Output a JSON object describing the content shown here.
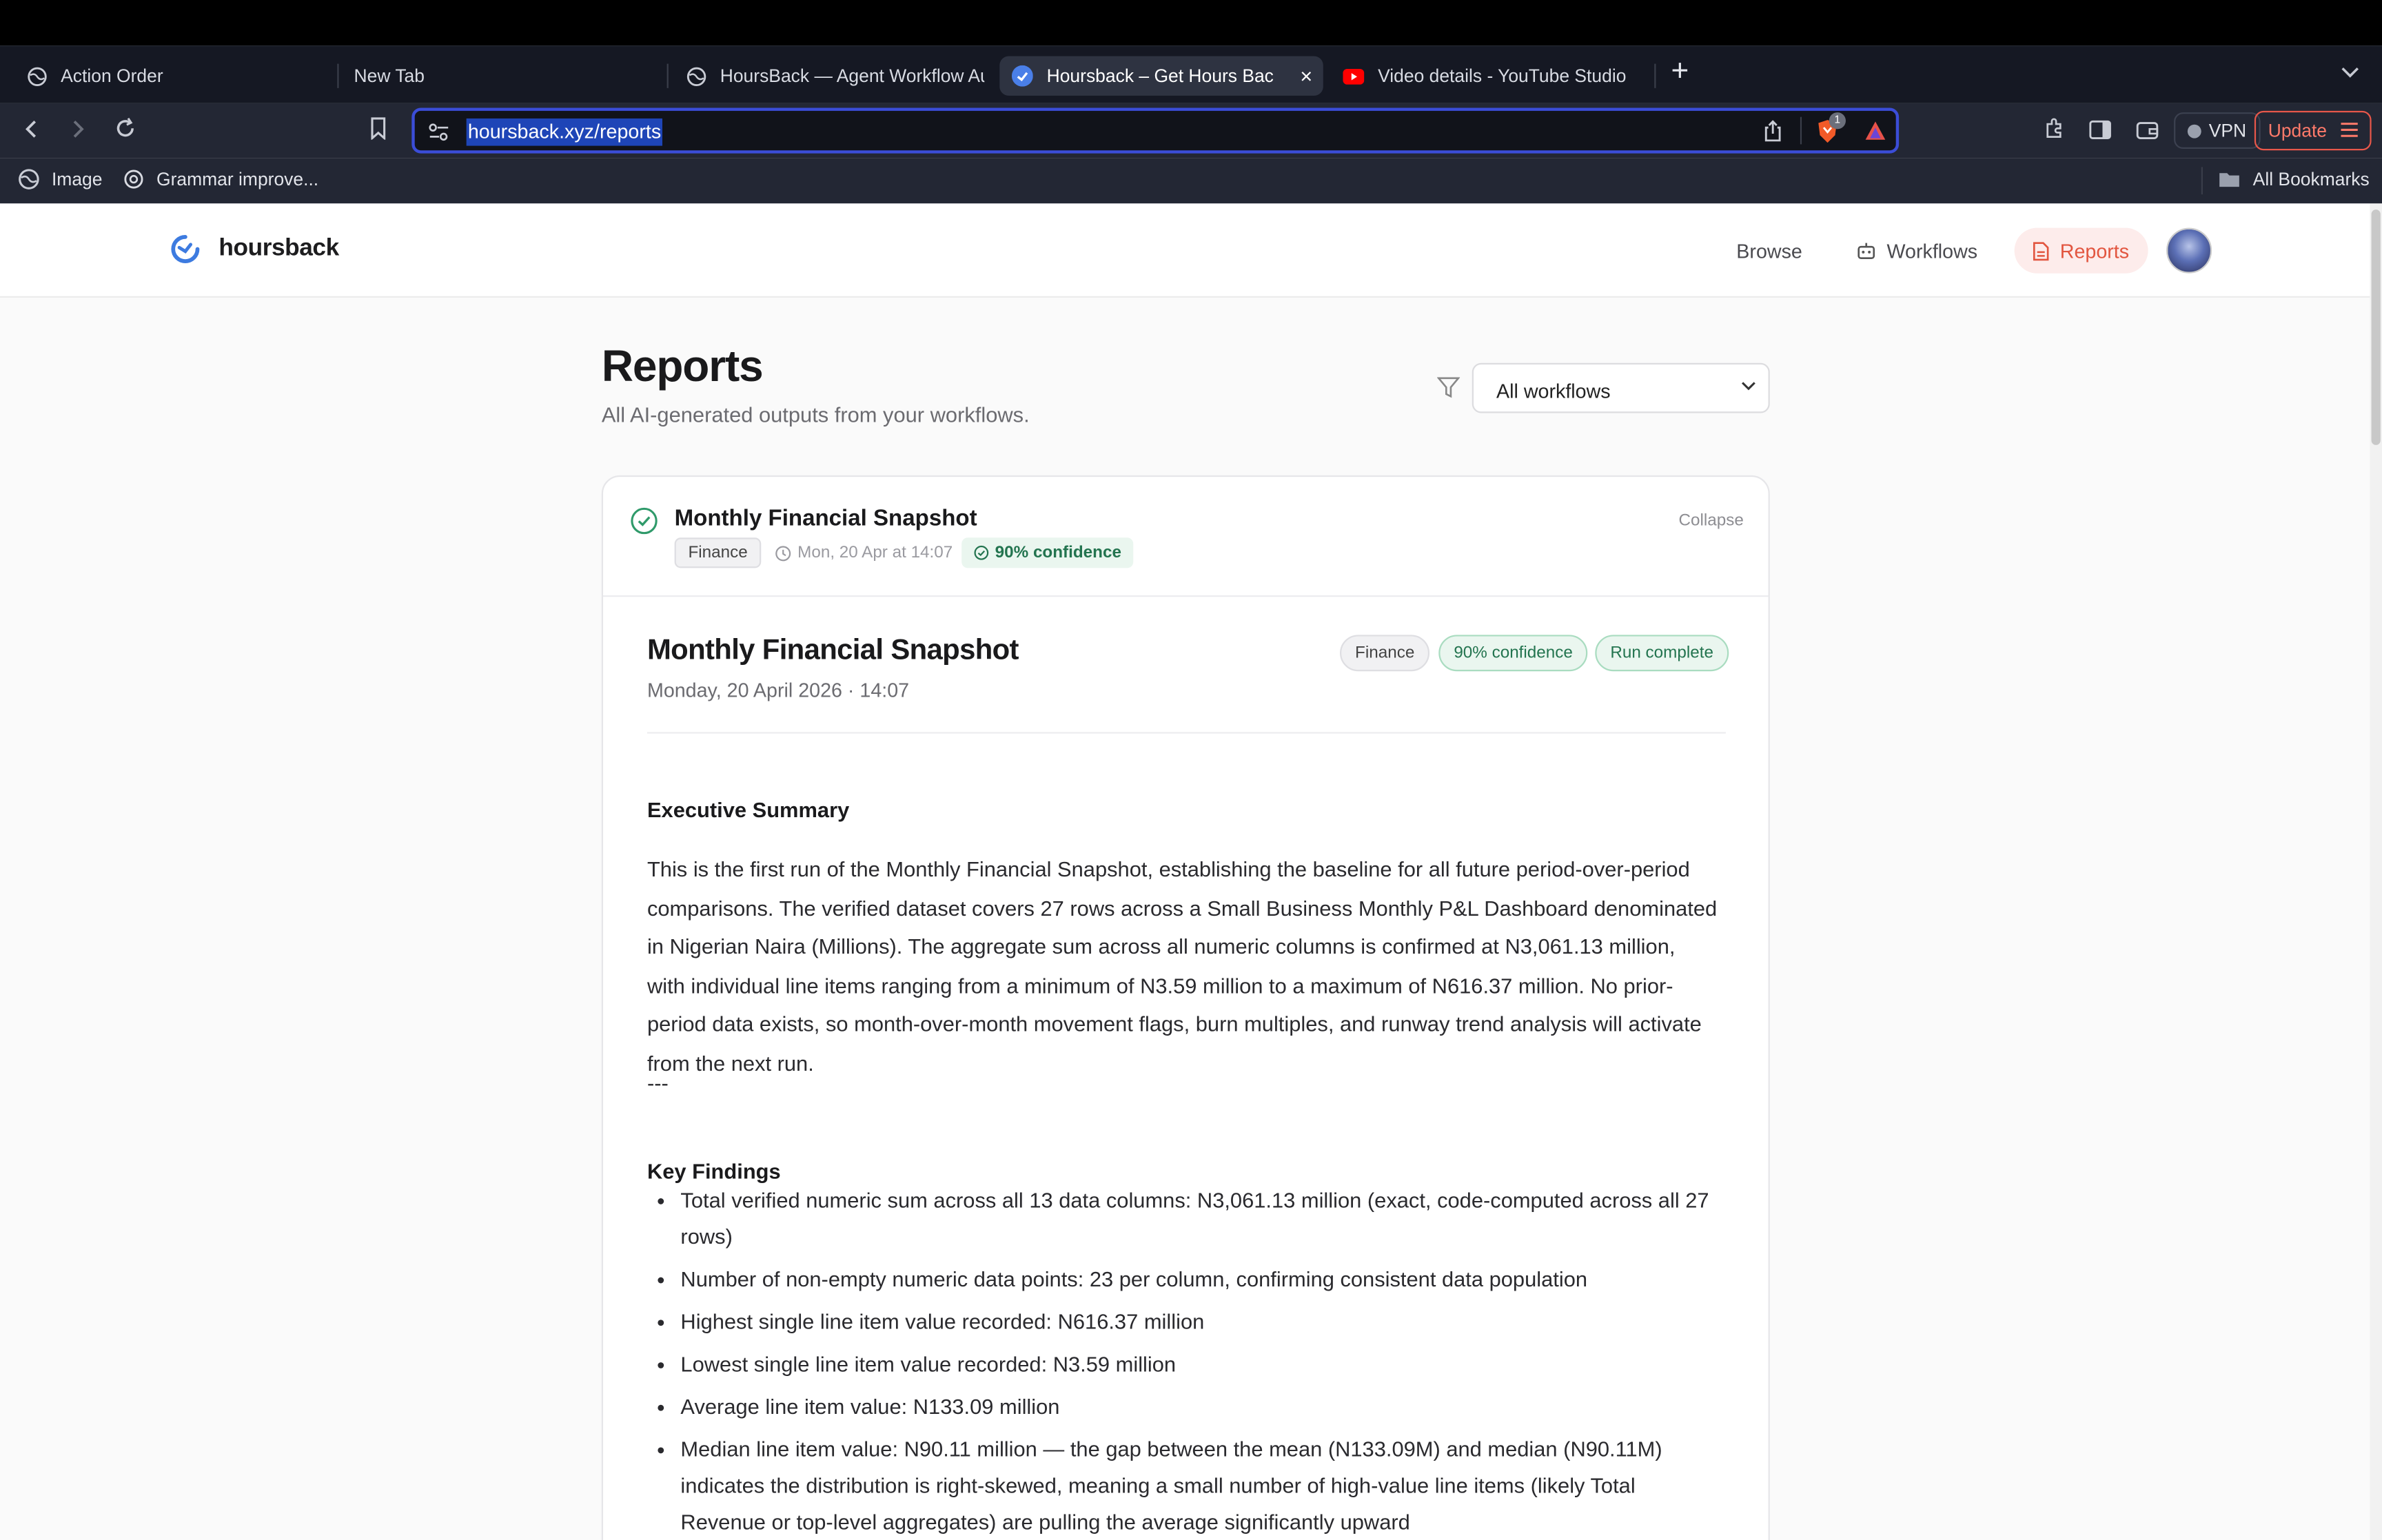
{
  "browser": {
    "tabs": [
      {
        "label": "Action Order",
        "icon": "globe-icon"
      },
      {
        "label": "New Tab",
        "icon": ""
      },
      {
        "label": "HoursBack — Agent Workflow Aut",
        "icon": "globe-icon"
      },
      {
        "label": "Hoursback – Get Hours Back f",
        "icon": "hoursback-icon"
      },
      {
        "label": "Video details - YouTube Studio",
        "icon": "youtube-icon"
      }
    ],
    "url": "hoursback.xyz/reports",
    "brave_badge_count": "1",
    "vpn_label": "VPN",
    "update_label": "Update",
    "bookmarks": [
      {
        "label": "Image",
        "icon": "globe-icon"
      },
      {
        "label": "Grammar improve...",
        "icon": "openai-icon"
      }
    ],
    "all_bookmarks_label": "All Bookmarks"
  },
  "app": {
    "brand": "hoursback",
    "nav": {
      "browse": "Browse",
      "workflows": "Workflows",
      "reports": "Reports"
    }
  },
  "page": {
    "title": "Reports",
    "subtitle": "All AI-generated outputs from your workflows.",
    "filter_value": "All workflows"
  },
  "card": {
    "title": "Monthly Financial Snapshot",
    "category": "Finance",
    "timestamp": "Mon, 20 Apr at 14:07",
    "confidence": "90% confidence",
    "collapse_label": "Collapse"
  },
  "report": {
    "title": "Monthly Financial Snapshot",
    "date": "Monday, 20 April 2026 · 14:07",
    "badges": {
      "category": "Finance",
      "confidence": "90% confidence",
      "status": "Run complete"
    },
    "executive_summary_heading": "Executive Summary",
    "executive_summary": "This is the first run of the Monthly Financial Snapshot, establishing the baseline for all future period-over-period comparisons. The verified dataset covers 27 rows across a Small Business Monthly P&L Dashboard denominated in Nigerian Naira (Millions). The aggregate sum across all numeric columns is confirmed at N3,061.13 million, with individual line items ranging from a minimum of N3.59 million to a maximum of N616.37 million. No prior-period data exists, so month-over-month movement flags, burn multiples, and runway trend analysis will activate from the next run.",
    "separator": "---",
    "key_findings_heading": "Key Findings",
    "key_findings": [
      "Total verified numeric sum across all 13 data columns: N3,061.13 million (exact, code-computed across all 27 rows)",
      "Number of non-empty numeric data points: 23 per column, confirming consistent data population",
      "Highest single line item value recorded: N616.37 million",
      "Lowest single line item value recorded: N3.59 million",
      "Average line item value: N133.09 million",
      "Median line item value: N90.11 million — the gap between the mean (N133.09M) and median (N90.11M) indicates the distribution is right-skewed, meaning a small number of high-value line items (likely Total Revenue or top-level aggregates) are pulling the average significantly upward"
    ]
  },
  "colors": {
    "accent": "#e2553f",
    "success": "#2f9a6a",
    "url_highlight": "#1e45b7"
  }
}
